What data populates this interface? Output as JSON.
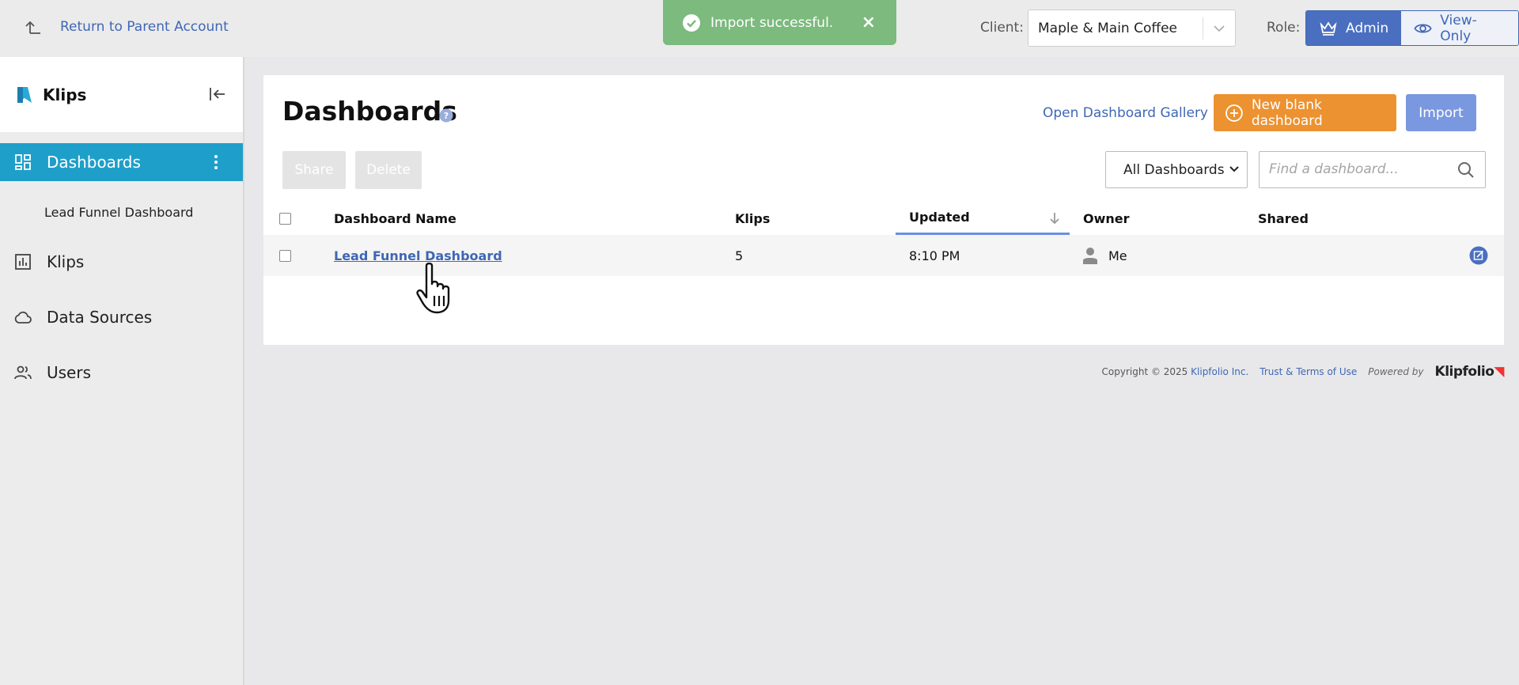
{
  "topbar": {
    "return_label": "Return to Parent Account",
    "toast_message": "Import successful.",
    "toast_close": "×",
    "client_label": "Client:",
    "client_value": "Maple & Main Coffee",
    "role_label": "Role:",
    "roles": [
      {
        "label": "Admin",
        "active": true
      },
      {
        "label": "View-Only",
        "active": false
      }
    ]
  },
  "sidebar": {
    "brand": "Klips",
    "items": [
      {
        "label": "Dashboards",
        "icon": "dashboard-grid-icon",
        "active": true
      },
      {
        "label": "Klips",
        "icon": "bar-chart-icon"
      },
      {
        "label": "Data Sources",
        "icon": "cloud-icon"
      },
      {
        "label": "Users",
        "icon": "users-icon"
      }
    ],
    "sub_items": [
      "Lead Funnel Dashboard"
    ]
  },
  "main": {
    "title": "Dashboards",
    "gallery_link": "Open Dashboard Gallery",
    "new_button": "New blank dashboard",
    "import_button": "Import",
    "share_button": "Share",
    "delete_button": "Delete",
    "filter_value": "All Dashboards",
    "search_placeholder": "Find a dashboard...",
    "table": {
      "columns": [
        "Dashboard Name",
        "Klips",
        "Updated",
        "Owner",
        "Shared"
      ],
      "sort_column": "Updated",
      "rows": [
        {
          "name": "Lead Funnel Dashboard",
          "klips": "5",
          "updated": "8:10 PM",
          "owner": "Me",
          "shared": ""
        }
      ]
    }
  },
  "footer": {
    "copyright": "Copyright © 2025",
    "company": "Klipfolio Inc.",
    "terms": "Trust & Terms of Use",
    "powered_by": "Powered by",
    "brandmark": "Klipfolio"
  },
  "colors": {
    "accent": "#1e9fc9",
    "link": "#3f67b5",
    "toast": "#7cba7e",
    "new_button": "#ec9230",
    "import_button": "#7a98e0"
  }
}
